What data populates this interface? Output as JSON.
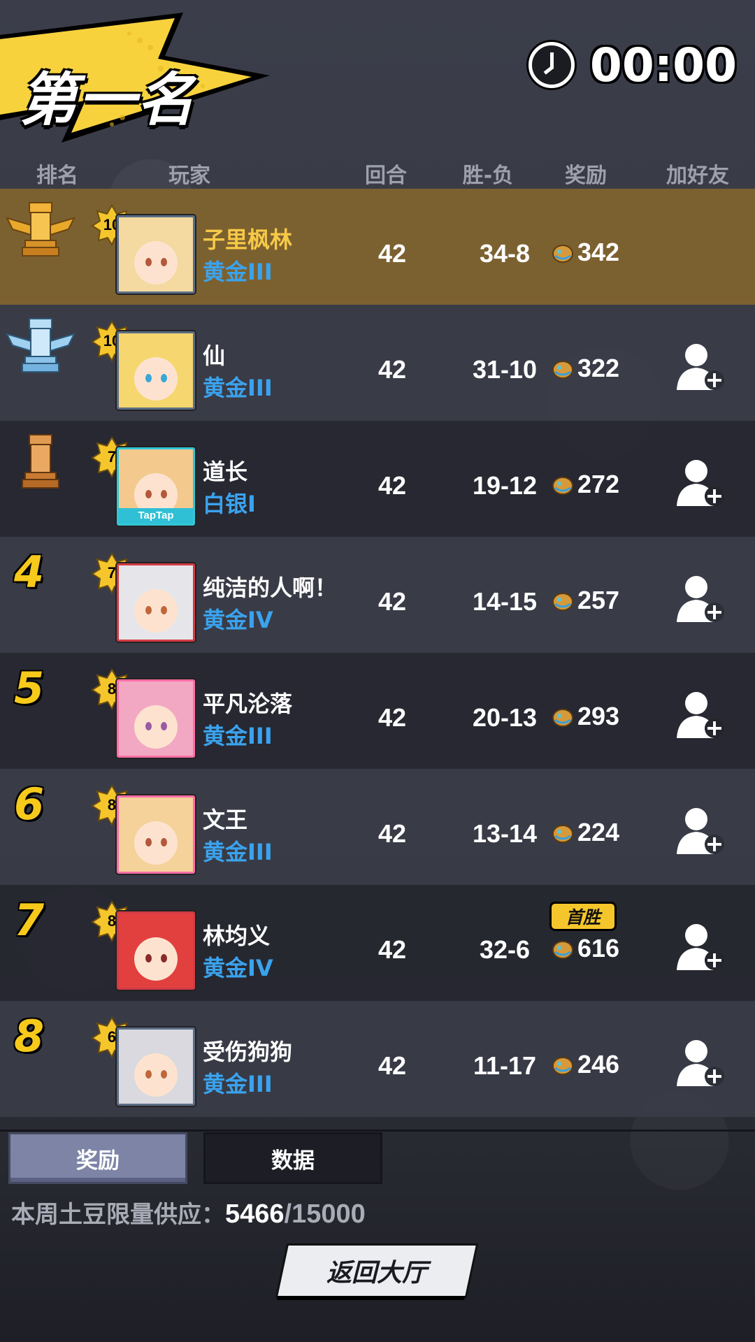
{
  "title": "第一名",
  "timer": "00:00",
  "headers": {
    "rank": "排名",
    "player": "玩家",
    "rounds": "回合",
    "winloss": "胜-负",
    "reward": "奖励",
    "add_friend": "加好友"
  },
  "players": [
    {
      "rank": "1",
      "rank_icon": "gold-winged-rook-icon",
      "level": "10",
      "name": "子里枫林",
      "tier": "黄金III",
      "rounds": "42",
      "winloss": "34-8",
      "reward": "342",
      "is_me": true,
      "avatar_hair": "#f4d9a0"
    },
    {
      "rank": "2",
      "rank_icon": "silver-winged-rook-icon",
      "level": "10",
      "name": "仙",
      "tier": "黄金III",
      "rounds": "42",
      "winloss": "31-10",
      "reward": "322",
      "avatar_hair": "#f6d66e"
    },
    {
      "rank": "3",
      "rank_icon": "bronze-rook-icon",
      "level": "7",
      "name": "道长",
      "tier": "白银I",
      "rounds": "42",
      "winloss": "19-12",
      "reward": "272",
      "avatar_hair": "#f3c98d",
      "avatar_text": "TapTap"
    },
    {
      "rank": "4",
      "level": "7",
      "name": "纯洁的人啊！",
      "tier": "黄金IV",
      "rounds": "42",
      "winloss": "14-15",
      "reward": "257",
      "avatar_hair": "#e6e6ea"
    },
    {
      "rank": "5",
      "level": "8",
      "name": "平凡沦落",
      "tier": "黄金III",
      "rounds": "42",
      "winloss": "20-13",
      "reward": "293",
      "avatar_hair": "#f2a8c3"
    },
    {
      "rank": "6",
      "level": "8",
      "name": "文王",
      "tier": "黄金III",
      "rounds": "42",
      "winloss": "13-14",
      "reward": "224",
      "avatar_hair": "#f4d29a"
    },
    {
      "rank": "7",
      "level": "8",
      "name": "林均义",
      "tier": "黄金IV",
      "rounds": "42",
      "winloss": "32-6",
      "reward": "616",
      "first_win": "首胜",
      "avatar_hair": "#e2403f"
    },
    {
      "rank": "8",
      "level": "6",
      "name": "受伤狗狗",
      "tier": "黄金III",
      "rounds": "42",
      "winloss": "11-17",
      "reward": "246",
      "avatar_hair": "#d9d9df"
    }
  ],
  "tabs": {
    "rewards": "奖励",
    "data": "数据"
  },
  "supply": {
    "label": "本周土豆限量供应：",
    "current": "5466",
    "sep": "/",
    "max": "15000"
  },
  "back_button": "返回大厅",
  "colors": {
    "gold": "#f6c91b",
    "tier_blue": "#3aa3ee",
    "me_row": "#7c6130"
  }
}
